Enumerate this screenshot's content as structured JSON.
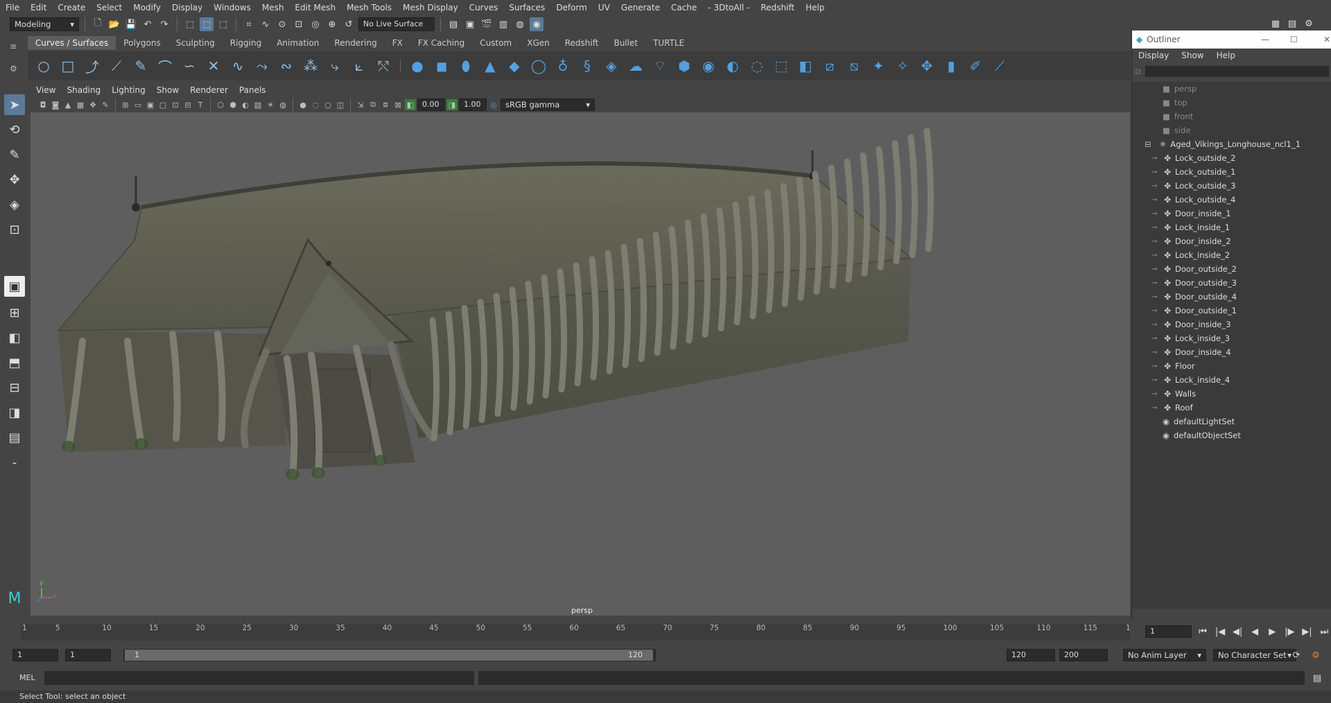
{
  "menubar": {
    "items": [
      "File",
      "Edit",
      "Create",
      "Select",
      "Modify",
      "Display",
      "Windows",
      "Mesh",
      "Edit Mesh",
      "Mesh Tools",
      "Mesh Display",
      "Curves",
      "Surfaces",
      "Deform",
      "UV",
      "Generate",
      "Cache",
      "- 3DtoAll -",
      "Redshift",
      "Help"
    ]
  },
  "statusline": {
    "menu_set": "Modeling",
    "live_surface": "No Live Surface"
  },
  "shelf": {
    "tabs": [
      "Curves / Surfaces",
      "Polygons",
      "Sculpting",
      "Rigging",
      "Animation",
      "Rendering",
      "FX",
      "FX Caching",
      "Custom",
      "XGen",
      "Redshift",
      "Bullet",
      "TURTLE"
    ],
    "active_tab": "Curves / Surfaces"
  },
  "viewport": {
    "menus": [
      "View",
      "Shading",
      "Lighting",
      "Show",
      "Renderer",
      "Panels"
    ],
    "exposure": "0.00",
    "gamma": "1.00",
    "color_space": "sRGB gamma",
    "camera_label": "persp",
    "axis_x": "x",
    "axis_y": "y"
  },
  "outliner": {
    "title": "Outliner",
    "menus": [
      "Display",
      "Show",
      "Help"
    ],
    "cameras": [
      "persp",
      "top",
      "front",
      "side"
    ],
    "group": "Aged_Vikings_Longhouse_ncl1_1",
    "children": [
      "Lock_outside_2",
      "Lock_outside_1",
      "Lock_outside_3",
      "Lock_outside_4",
      "Door_inside_1",
      "Lock_inside_1",
      "Door_inside_2",
      "Lock_inside_2",
      "Door_outside_2",
      "Door_outside_3",
      "Door_outside_4",
      "Door_outside_1",
      "Door_inside_3",
      "Lock_inside_3",
      "Door_inside_4",
      "Floor",
      "Lock_inside_4",
      "Walls",
      "Roof"
    ],
    "sets": [
      "defaultLightSet",
      "defaultObjectSet"
    ]
  },
  "timeline": {
    "ticks": [
      "1",
      "5",
      "10",
      "15",
      "20",
      "25",
      "30",
      "35",
      "40",
      "45",
      "50",
      "55",
      "60",
      "65",
      "70",
      "75",
      "80",
      "85",
      "90",
      "95",
      "100",
      "105",
      "110",
      "115",
      "1"
    ],
    "current_frame": "1"
  },
  "range": {
    "start": "1",
    "anim_start": "1",
    "slider_start": "1",
    "slider_end": "120",
    "end": "120",
    "anim_end": "200",
    "anim_layer": "No Anim Layer",
    "character_set": "No Character Set"
  },
  "command": {
    "lang": "MEL"
  },
  "help": {
    "text": "Select Tool: select an object"
  }
}
